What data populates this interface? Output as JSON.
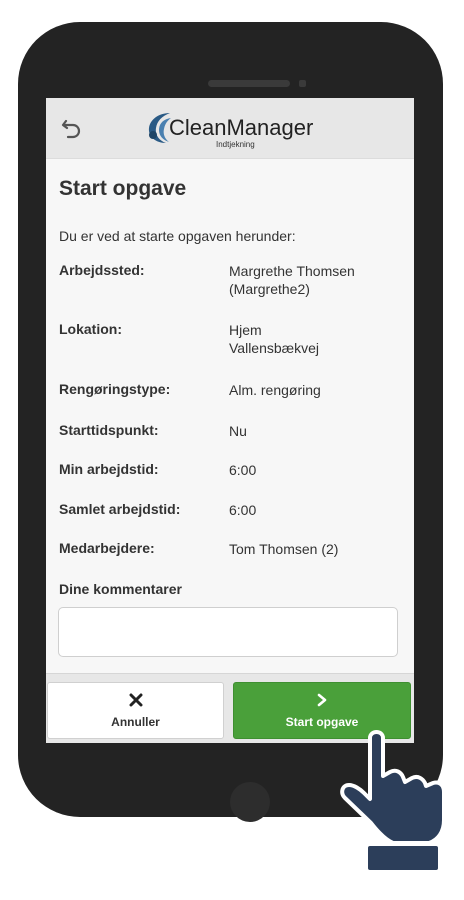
{
  "header": {
    "brand_name": "CleanManager",
    "brand_subtitle": "Indtjekning"
  },
  "page": {
    "title": "Start opgave",
    "intro": "Du er ved at starte opgaven herunder:"
  },
  "fields": [
    {
      "label": "Arbejdssted:",
      "value_lines": [
        "Margrethe Thomsen",
        "(Margrethe2)"
      ]
    },
    {
      "label": "Lokation:",
      "value_lines": [
        "Hjem",
        "Vallensbækvej"
      ]
    },
    {
      "label": "Rengøringstype:",
      "value_lines": [
        "Alm. rengøring"
      ]
    },
    {
      "label": "Starttidspunkt:",
      "value_lines": [
        "Nu"
      ]
    },
    {
      "label": "Min arbejdstid:",
      "value_lines": [
        "6:00"
      ]
    },
    {
      "label": "Samlet arbejdstid:",
      "value_lines": [
        "6:00"
      ]
    },
    {
      "label": "Medarbejdere:",
      "value_lines": [
        "Tom Thomsen (2)"
      ]
    }
  ],
  "comments": {
    "label": "Dine kommentarer",
    "value": "",
    "placeholder": ""
  },
  "footer": {
    "cancel_label": "Annuller",
    "cancel_icon": "close-icon",
    "start_label": "Start opgave",
    "start_icon": "chevron-right-icon"
  },
  "icons": {
    "back": "undo-arrow-icon",
    "logo": "cleanmanager-logo-mark",
    "pointer": "pointing-hand-icon"
  },
  "colors": {
    "start_button": "#4aa03a",
    "header_bg": "#e7e7e7",
    "phone_body": "#232323",
    "hand": "#2c3e5a",
    "logo_mark": "#3d6d9a"
  }
}
